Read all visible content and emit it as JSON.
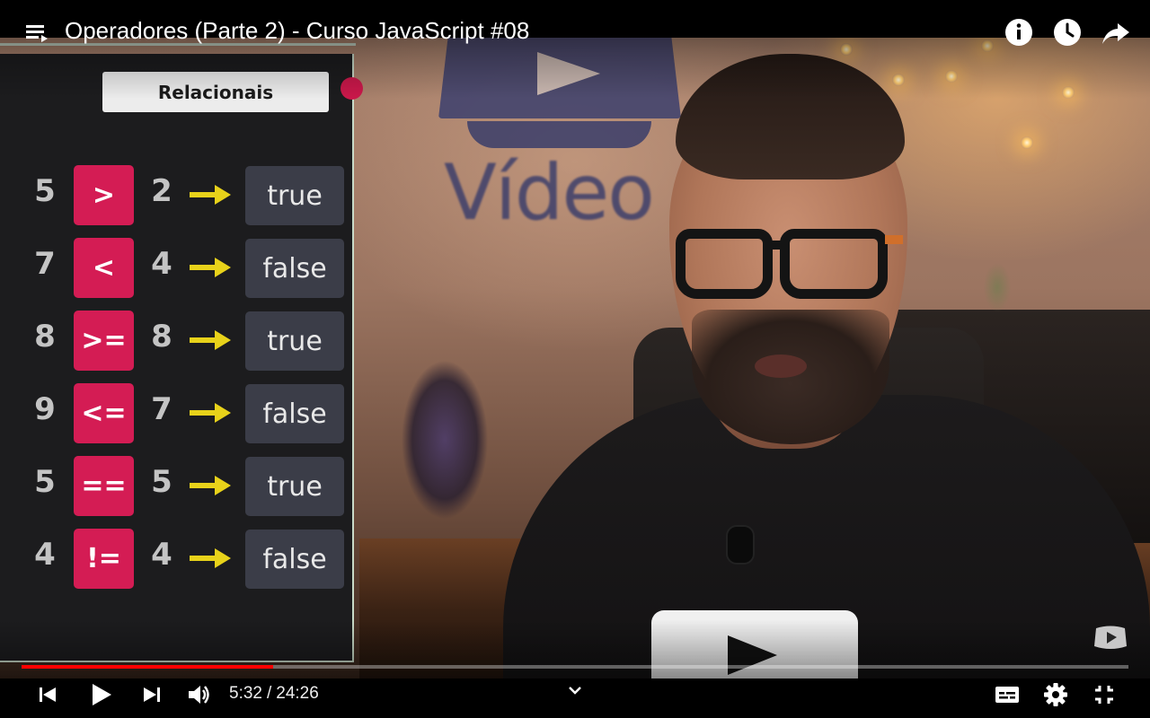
{
  "video": {
    "title": "Operadores (Parte 2) - Curso JavaScript #08"
  },
  "top_icons": [
    "playlist-icon",
    "info-icon",
    "watch-later-icon",
    "share-icon"
  ],
  "panel": {
    "title": "Relacionais",
    "rows": [
      {
        "a": "5",
        "op": ">",
        "b": "2",
        "result": "true"
      },
      {
        "a": "7",
        "op": "<",
        "b": "4",
        "result": "false"
      },
      {
        "a": "8",
        "op": ">=",
        "b": "8",
        "result": "true"
      },
      {
        "a": "9",
        "op": "<=",
        "b": "7",
        "result": "false"
      },
      {
        "a": "5",
        "op": "==",
        "b": "5",
        "result": "true"
      },
      {
        "a": "4",
        "op": "!=",
        "b": "4",
        "result": "false"
      }
    ],
    "colors": {
      "operator": "#d41c54",
      "arrow": "#e8d21a",
      "result_bg": "#3b3d48",
      "accent_dot": "#c9184a"
    }
  },
  "scene": {
    "background_text": "Vídeo"
  },
  "controls": {
    "current_time": "5:32",
    "duration": "24:26",
    "separator": "/",
    "progress_fraction": 0.227,
    "progress_color": "#ff0000",
    "icons": [
      "previous-icon",
      "play-icon",
      "next-icon",
      "volume-icon",
      "chevron-down-icon",
      "captions-icon",
      "settings-icon",
      "exit-fullscreen-icon"
    ]
  }
}
